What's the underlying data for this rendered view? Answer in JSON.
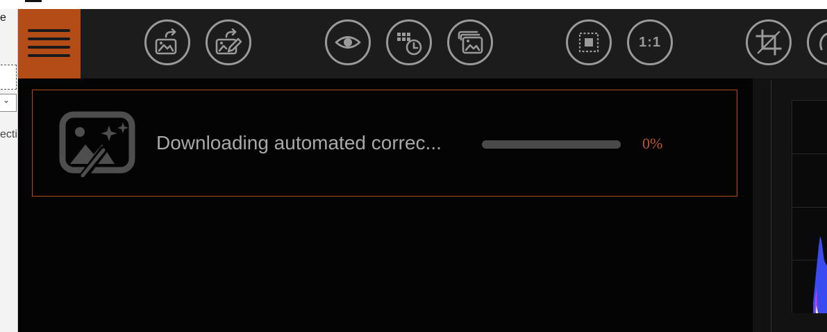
{
  "background_window": {
    "partial_text_top": "e",
    "partial_text_lower": "ecti",
    "dropdown_chevron": "⌄"
  },
  "toolbar": {
    "menu_icon": "hamburger-icon",
    "buttons": [
      {
        "name": "export-image",
        "icon": "image-export-icon"
      },
      {
        "name": "export-edit",
        "icon": "image-edit-export-icon"
      },
      {
        "name": "preview",
        "icon": "eye-icon"
      },
      {
        "name": "batch-history",
        "icon": "grid-clock-icon"
      },
      {
        "name": "compare",
        "icon": "stacked-images-icon"
      },
      {
        "name": "fit",
        "icon": "fit-frame-icon"
      },
      {
        "name": "actual-size",
        "label": "1:1"
      },
      {
        "name": "crop",
        "icon": "crop-icon"
      }
    ]
  },
  "notification": {
    "icon": "magic-image-icon",
    "message": "Downloading automated correc...",
    "progress_percent": 0,
    "progress_text": "0%"
  },
  "colors": {
    "accent": "#b34c16",
    "toolbar_bg": "#1c1c1c",
    "icon_gray": "#9a9a9a",
    "progress_track": "#4a4a4a",
    "percent_text": "#c2552a",
    "histogram_blue": "#3a4cf0",
    "histogram_magenta": "#c040e0"
  }
}
